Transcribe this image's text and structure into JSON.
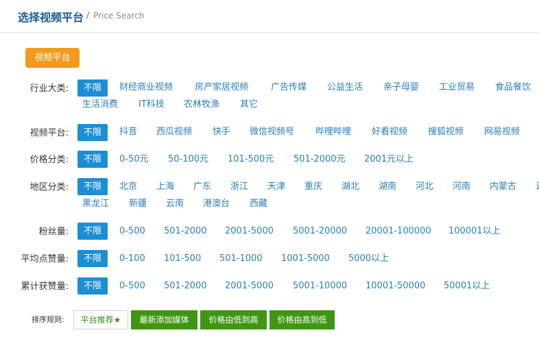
{
  "header": {
    "title": "选择视频平台",
    "sep": "/",
    "sub": "Price Search"
  },
  "tab": {
    "label": "视频平台"
  },
  "all_label": "不限",
  "filters": {
    "industry": {
      "label": "行业大类:",
      "options": [
        "财经商业视频",
        "房产家居视频",
        "广告传媒",
        "公益生活",
        "亲子母婴",
        "工业贸易",
        "食品餐饮",
        "生活消费",
        "IT科技",
        "农林牧渔",
        "其它"
      ]
    },
    "platform": {
      "label": "视频平台:",
      "options": [
        "抖音",
        "西瓜视频",
        "快手",
        "微信视频号",
        "哔哩哔哩",
        "好看视频",
        "搜狐视频",
        "网易视频"
      ]
    },
    "price": {
      "label": "价格分类:",
      "options": [
        "0-50元",
        "50-100元",
        "101-500元",
        "501-2000元",
        "2001元以上"
      ]
    },
    "region": {
      "label": "地区分类:",
      "options": [
        "北京",
        "上海",
        "广东",
        "浙江",
        "天津",
        "重庆",
        "湖北",
        "湖南",
        "河北",
        "河南",
        "内蒙古",
        "辽",
        "黑龙江",
        "新疆",
        "云南",
        "港澳台",
        "西藏"
      ]
    },
    "fans": {
      "label": "粉丝量:",
      "options": [
        "0-500",
        "501-2000",
        "2001-5000",
        "5001-20000",
        "20001-100000",
        "100001以上"
      ]
    },
    "avg_likes": {
      "label": "平均点赞量:",
      "options": [
        "0-100",
        "101-500",
        "501-1000",
        "1001-5000",
        "5000以上"
      ]
    },
    "total_likes": {
      "label": "累计获赞量:",
      "options": [
        "0-500",
        "501-2000",
        "2001-5000",
        "5001-10000",
        "10001-50000",
        "50001以上"
      ]
    }
  },
  "sort": {
    "label": "排序规则:",
    "buttons": [
      "平台推荐★",
      "最新添加媒体",
      "价格由低到高",
      "价格由高到低"
    ]
  }
}
